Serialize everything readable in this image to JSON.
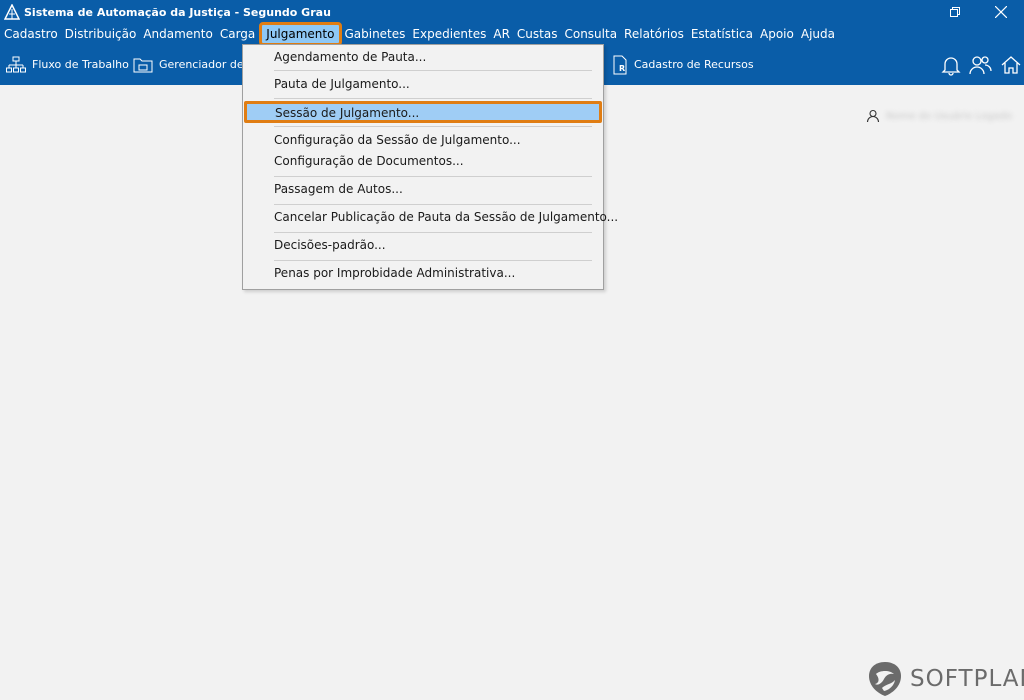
{
  "window": {
    "title": "Sistema de Automação da Justiça - Segundo Grau"
  },
  "menubar": {
    "items": [
      "Cadastro",
      "Distribuição",
      "Andamento",
      "Carga",
      "Julgamento",
      "Gabinetes",
      "Expedientes",
      "AR",
      "Custas",
      "Consulta",
      "Relatórios",
      "Estatística",
      "Apoio",
      "Ajuda"
    ],
    "active": "Julgamento"
  },
  "toolbar": {
    "fluxo_label": "Fluxo de Trabalho",
    "gerenciador_label": "Gerenciador de A",
    "recursos_label": "Cadastro de Recursos"
  },
  "dropdown": {
    "items": [
      "Agendamento de Pauta...",
      "Pauta de Julgamento...",
      "Sessão de Julgamento...",
      "Configuração da Sessão de Julgamento...",
      "Configuração de Documentos...",
      "Passagem de Autos...",
      "Cancelar Publicação de Pauta da Sessão de Julgamento...",
      "Decisões-padrão...",
      "Penas por Improbidade Administrativa..."
    ],
    "selected": "Sessão de Julgamento..."
  },
  "user": {
    "name": "Nome do Usuário Logado"
  },
  "brand": {
    "name": "SOFTPLAN"
  },
  "colors": {
    "header_bg": "#0a5da8",
    "highlight": "#e07d13",
    "selection_bg": "#9fcdf5"
  }
}
